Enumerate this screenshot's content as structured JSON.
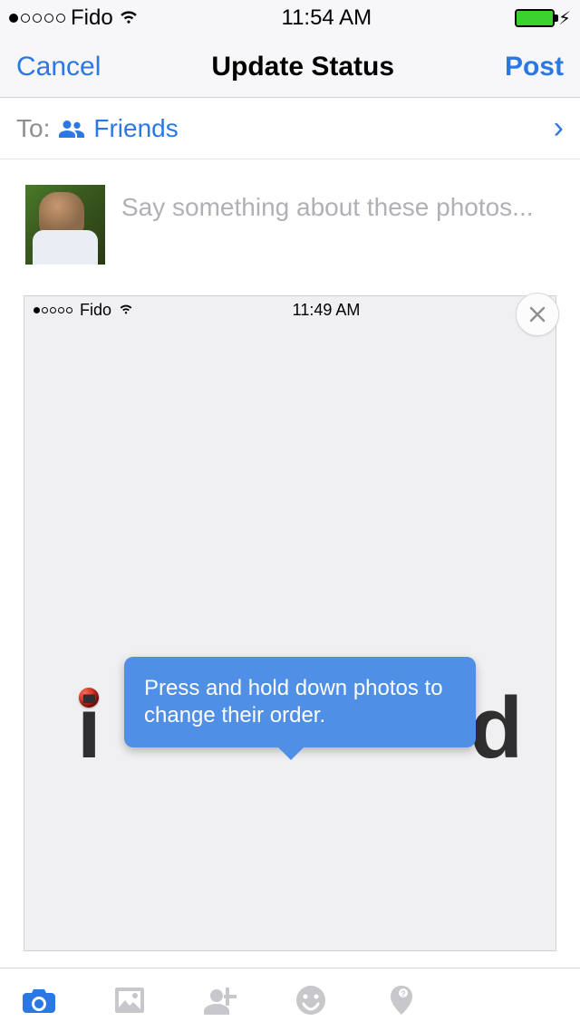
{
  "statusBar": {
    "carrier": "Fido",
    "time": "11:54 AM",
    "batteryPercent": 100
  },
  "nav": {
    "cancel": "Cancel",
    "title": "Update Status",
    "post": "Post"
  },
  "audience": {
    "toLabel": "To:",
    "value": "Friends"
  },
  "compose": {
    "placeholder": "Say something about these photos..."
  },
  "innerScreenshot": {
    "carrier": "Fido",
    "time": "11:49 AM",
    "logoLeft": "i",
    "logoRight": "d"
  },
  "tooltip": {
    "text": "Press and hold down photos to change their order."
  },
  "toolbar": {
    "camera": "camera",
    "album": "album",
    "tag": "tag-person",
    "emoji": "emoji",
    "location": "location"
  }
}
